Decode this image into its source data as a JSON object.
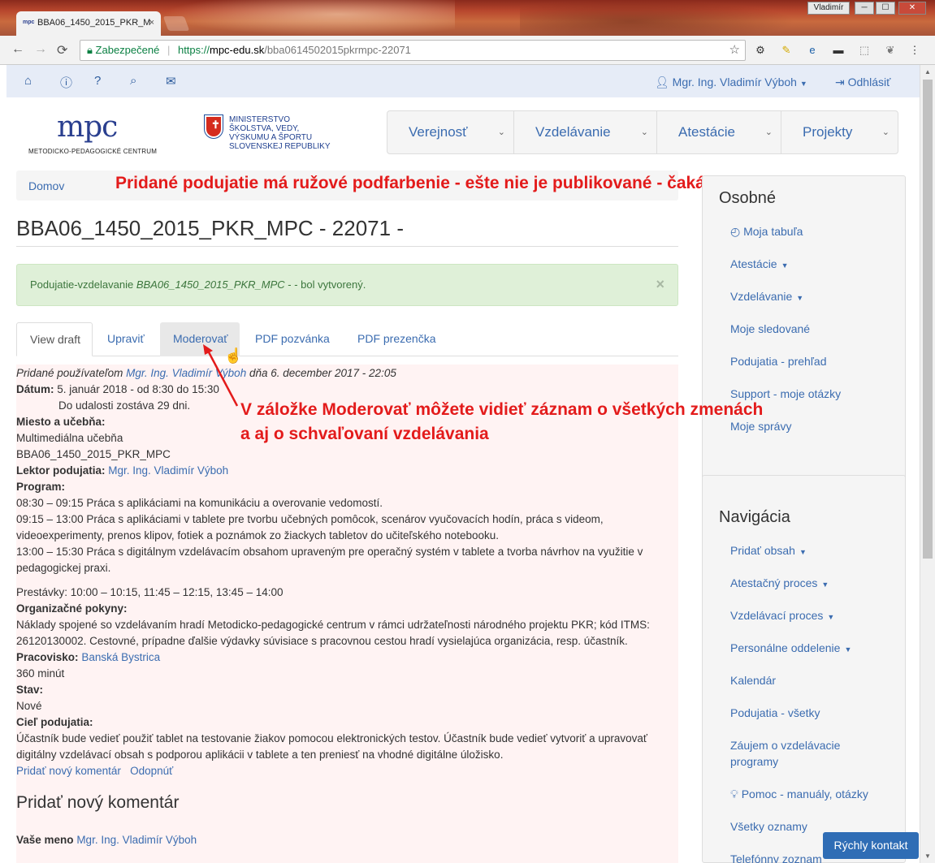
{
  "browser": {
    "tab_title": "BBA06_1450_2015_PKR_M",
    "tab_favicon": "mpc",
    "tab_close": "×",
    "profile_name": "Vladimír",
    "minimize": "─",
    "maximize": "☐",
    "close": "✕",
    "back_icon": "←",
    "forward_icon": "→",
    "reload_icon": "C",
    "secure_label": "Zabezpečené",
    "url_protocol": "https://",
    "url_host": "mpc-edu.sk",
    "url_path": "/bba0614502015pkrmpc-22071",
    "star_icon": "☆"
  },
  "topnav": {
    "user": "Mgr. Ing. Vladimír Výboh",
    "logout": "Odhlásiť"
  },
  "logos": {
    "mpc": "mpc",
    "mpc_sub": "METODICKO-PEDAGOGICKÉ CENTRUM",
    "ministry_line1": "MINISTERSTVO",
    "ministry_line2": "ŠKOLSTVA, VEDY,",
    "ministry_line3": "VÝSKUMU A ŠPORTU",
    "ministry_line4": "SLOVENSKEJ REPUBLIKY"
  },
  "mainmenu": [
    "Verejnosť",
    "Vzdelávanie",
    "Atestácie",
    "Projekty"
  ],
  "breadcrumb": "Domov",
  "annotation_top": "Pridané podujatie má ružové podfarbenie - ešte nie je publikované - čaká na schválenie",
  "page_title": "BBA06_1450_2015_PKR_MPC - 22071 -",
  "alert": {
    "prefix": "Podujatie-vzdelavanie ",
    "name": "BBA06_1450_2015_PKR_MPC",
    "suffix": " - - bol vytvorený.",
    "close": "×"
  },
  "tabs": [
    "View draft",
    "Upraviť",
    "Moderovať",
    "PDF pozvánka",
    "PDF prezenčka"
  ],
  "annotation_mid_1": "V záložke Moderovať môžete vidieť záznam o všetkých zmenách",
  "annotation_mid_2": " a aj o schvaľovaní vzdelávania",
  "content": {
    "submitted_prefix": "Pridané používateľom ",
    "submitted_user": "Mgr. Ing. Vladimír Výboh",
    "submitted_suffix": " dňa 6. december 2017 - 22:05",
    "date_label": "Dátum:",
    "date_value": " 5. január 2018 - od 8:30 do 15:30",
    "date_remaining": "Do udalosti zostáva 29 dni.",
    "place_label": "Miesto a učebňa:",
    "place_line1": "Multimediálna učebňa",
    "place_line2": "BBA06_1450_2015_PKR_MPC",
    "lector_label": "Lektor podujatia:",
    "lector_value": "Mgr. Ing. Vladimír Výboh",
    "program_label": "Program:",
    "program_1": "08:30 – 09:15 Práca s aplikáciami na komunikáciu a overovanie vedomostí.",
    "program_2": "09:15 – 13:00 Práca s aplikáciami v tablete pre tvorbu učebných pomôcok, scenárov vyučovacích hodín, práca s videom,",
    "program_3": "videoexperimenty, prenos klipov, fotiek a poznámok zo žiackych tabletov do učiteľského notebooku.",
    "program_4": "13:00 – 15:30 Práca s digitálnym vzdelávacím obsahom upraveným pre operačný systém v tablete a tvorba návrhov na využitie v",
    "program_5": "pedagogickej praxi.",
    "breaks": "Prestávky: 10:00 – 10:15, 11:45 – 12:15, 13:45 – 14:00",
    "org_label": "Organizačné pokyny:",
    "org_1": "Náklady spojené so vzdelávaním hradí Metodicko-pedagogické centrum v rámci udržateľnosti národného projektu PKR; kód ITMS:",
    "org_2": "26120130002. Cestovné, prípadne ďalšie výdavky súvisiace s pracovnou cestou hradí vysielajúca organizácia, resp. účastník.",
    "work_label": "Pracovisko:",
    "work_value": "Banská Bystrica",
    "duration": "360 minút",
    "state_label": "Stav:",
    "state_value": "Nové",
    "goal_label": "Cieľ podujatia:",
    "goal_1": "Účastník bude vedieť použiť tablet na testovanie žiakov pomocou elektronických testov. Účastník bude vedieť vytvoriť a upravovať",
    "goal_2": "digitálny vzdelávací obsah s podporou aplikácii v tablete a ten preniesť na vhodné digitálne úložisko.",
    "link_comment": "Pridať nový komentár",
    "link_unsubscribe": "Odopnúť",
    "comment_heading": "Pridať nový komentár",
    "name_label": "Vaše meno",
    "name_value": "Mgr. Ing. Vladimír Výboh"
  },
  "sidebar_personal": {
    "title": "Osobné",
    "items": [
      "Moja tabuľa",
      "Atestácie",
      "Vzdelávanie",
      "Moje sledované",
      "Podujatia - prehľad",
      "Support - moje otázky",
      "Moje správy"
    ]
  },
  "sidebar_nav": {
    "title": "Navigácia",
    "items": [
      "Pridať obsah",
      "Atestačný proces",
      "Vzdelávací proces",
      "Personálne oddelenie",
      "Kalendár",
      "Podujatia - všetky",
      "Záujem o vzdelávacie",
      "programy",
      "Pomoc - manuály, otázky",
      "Všetky oznamy",
      "Telefónny zoznam"
    ]
  },
  "quick_contact": "Rýchly kontakt",
  "colors": {
    "accent": "#3b6cb0",
    "annotation": "#e31b1b",
    "draft_background": "#fff3f3",
    "alert_background": "#dff0d8"
  }
}
